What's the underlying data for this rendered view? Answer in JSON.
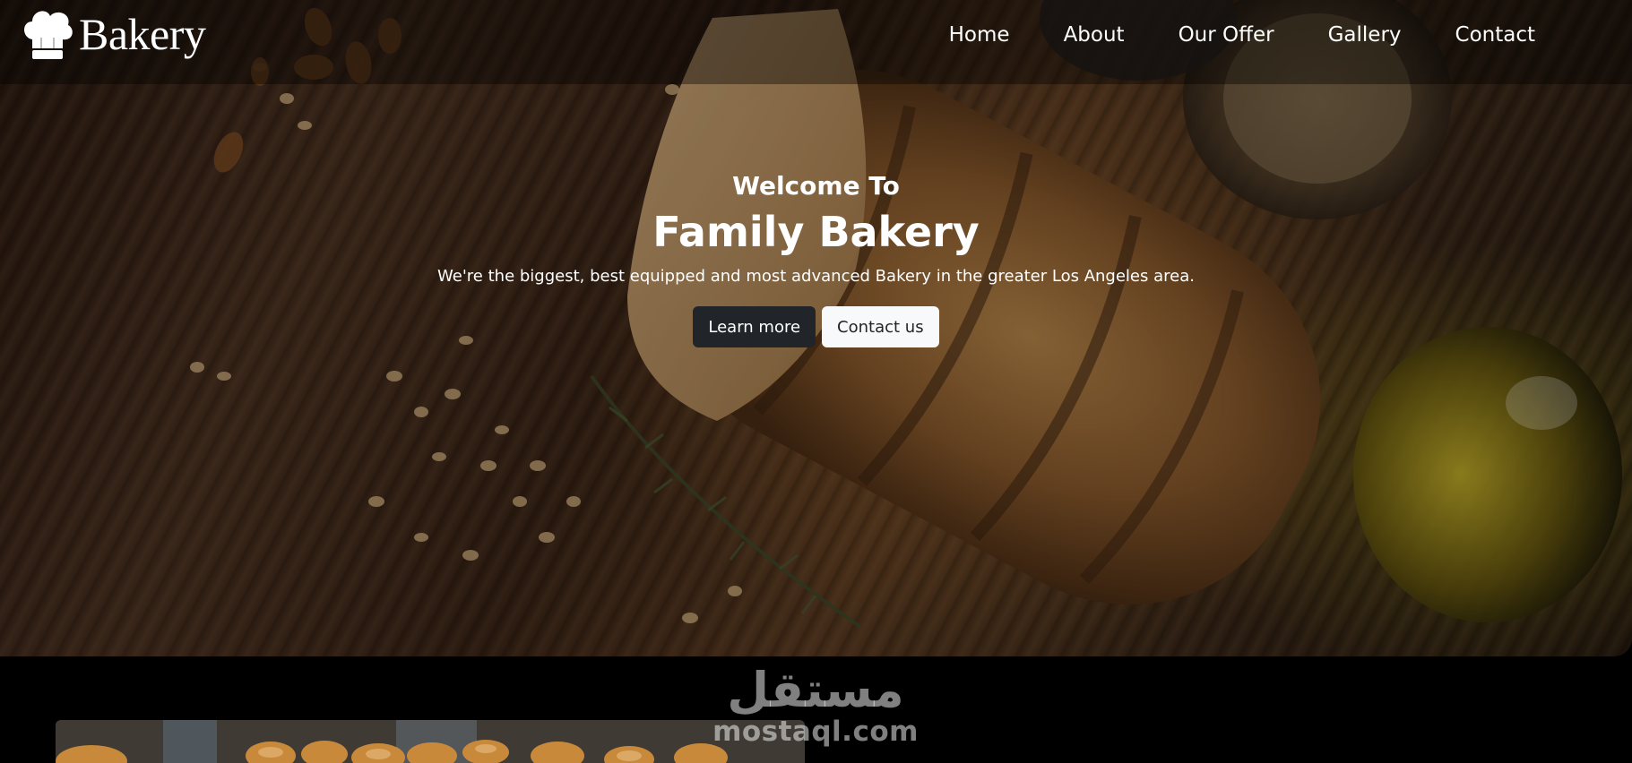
{
  "brand": {
    "name": "Bakery",
    "icon": "chef-hat-icon"
  },
  "nav": {
    "items": [
      {
        "label": "Home"
      },
      {
        "label": "About"
      },
      {
        "label": "Our Offer"
      },
      {
        "label": "Gallery"
      },
      {
        "label": "Contact"
      }
    ]
  },
  "hero": {
    "kicker": "Welcome To",
    "title": "Family Bakery",
    "subtitle": "We're the biggest, best equipped and most advanced Bakery in the greater Los Angeles area.",
    "buttons": {
      "primary": "Learn more",
      "secondary": "Contact us"
    }
  },
  "watermark": {
    "arabic": "مستقل",
    "latin": "mostaql.com"
  },
  "colors": {
    "primary_button": "#212529",
    "secondary_button": "#f8f9fa",
    "page_background": "#000000"
  }
}
